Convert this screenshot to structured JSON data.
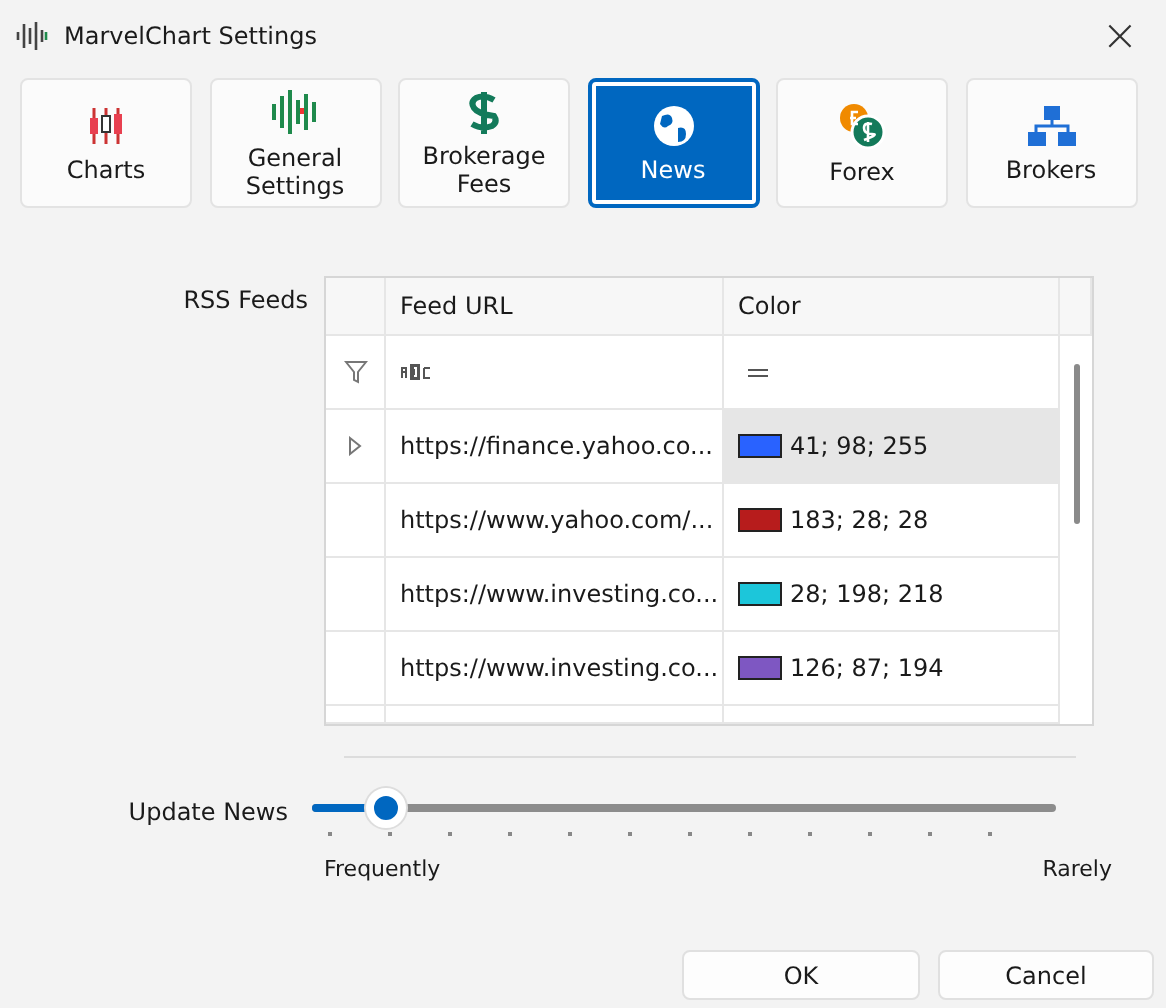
{
  "window": {
    "title": "MarvelChart Settings",
    "close": "×"
  },
  "tabs": [
    {
      "label": "Charts",
      "selected": false
    },
    {
      "label": "General\nSettings",
      "selected": false
    },
    {
      "label": "Brokerage\nFees",
      "selected": false
    },
    {
      "label": "News",
      "selected": true
    },
    {
      "label": "Forex",
      "selected": false
    },
    {
      "label": "Brokers",
      "selected": false
    }
  ],
  "rss_feeds": {
    "label": "RSS Feeds",
    "columns": [
      "Feed URL",
      "Color"
    ],
    "rows": [
      {
        "url": "https://finance.yahoo.co...",
        "color_text": "41; 98; 255",
        "color": "#2962ff",
        "selected": true
      },
      {
        "url": "https://www.yahoo.com/...",
        "color_text": "183; 28; 28",
        "color": "#b71c1c",
        "selected": false
      },
      {
        "url": "https://www.investing.co...",
        "color_text": "28; 198; 218",
        "color": "#1cc6da",
        "selected": false
      },
      {
        "url": "https://www.investing.co...",
        "color_text": "126; 87; 194",
        "color": "#7e57c2",
        "selected": false
      }
    ]
  },
  "update_news": {
    "label": "Update News",
    "level": 0.1,
    "min_label": "Frequently",
    "max_label": "Rarely"
  },
  "buttons": [
    "OK",
    "Cancel"
  ]
}
